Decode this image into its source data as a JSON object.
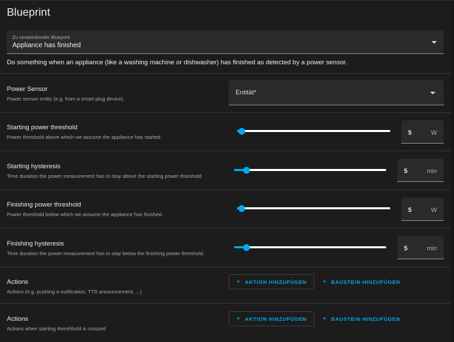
{
  "header": {
    "title": "Blueprint"
  },
  "blueprint_select": {
    "label": "Zu verwendender Blueprint",
    "value": "Appliance has finished"
  },
  "description": "Do something when an appliance (like a washing machine or dishwasher) has finished as detected by a power sensor.",
  "power_sensor": {
    "title": "Power Sensor",
    "subtitle": "Power sensor entity (e.g. from a smart plug device).",
    "select_value": "Entität*"
  },
  "rows": [
    {
      "title": "Starting power threshold",
      "subtitle": "Power threshold above which we assume the appliance has started.",
      "value": "5",
      "unit": "W",
      "slider_fraction": 0.03
    },
    {
      "title": "Starting hysteresis",
      "subtitle": "Time duration the power measurement has to stay above the starting power threshold.",
      "value": "5",
      "unit": "min",
      "slider_fraction": 0.08
    },
    {
      "title": "Finishing power threshold",
      "subtitle": "Power threshold below which we assume the appliance has finished.",
      "value": "5",
      "unit": "W",
      "slider_fraction": 0.03
    },
    {
      "title": "Finishing hysteresis",
      "subtitle": "Time duration the power measurement has to stay below the finishing power threshold.",
      "value": "5",
      "unit": "min",
      "slider_fraction": 0.08
    }
  ],
  "actions": [
    {
      "title": "Actions",
      "subtitle": "Actions (e.g. pushing a notification, TTS announcement, ...)",
      "add_action_label": "AKTION HINZUFÜGEN",
      "add_block_label": "BAUSTEIN HINZUFÜGEN"
    },
    {
      "title": "Actions",
      "subtitle": "Actions when starting threshhold is crossed",
      "add_action_label": "AKTION HINZUFÜGEN",
      "add_block_label": "BAUSTEIN HINZUFÜGEN"
    }
  ],
  "colors": {
    "accent": "#03a9f4",
    "background": "#1c1c1c",
    "field": "#2a2a2a"
  },
  "icons": {
    "dropdown": "chevron-down-icon",
    "add": "plus-icon"
  }
}
